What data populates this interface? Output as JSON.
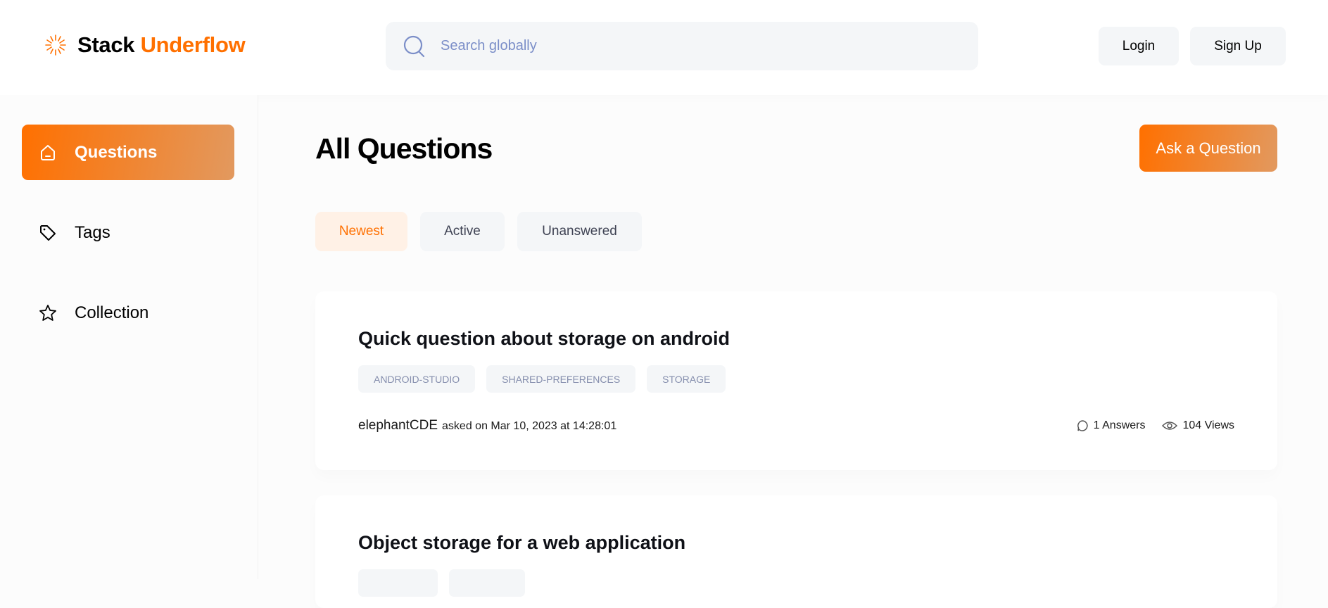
{
  "header": {
    "brand_first": "Stack",
    "brand_second": "Underflow",
    "search_placeholder": "Search globally",
    "login": "Login",
    "signup": "Sign Up"
  },
  "sidebar": {
    "items": [
      {
        "label": "Questions",
        "icon": "home-icon",
        "active": true
      },
      {
        "label": "Tags",
        "icon": "tag-icon"
      },
      {
        "label": "Collection",
        "icon": "star-icon"
      }
    ]
  },
  "main": {
    "title": "All Questions",
    "ask_button": "Ask a Question",
    "filters": [
      {
        "label": "Newest",
        "active": true
      },
      {
        "label": "Active"
      },
      {
        "label": "Unanswered"
      }
    ],
    "questions": [
      {
        "title": "Quick question about storage on android",
        "tags": [
          "android-studio",
          "shared-preferences",
          "storage"
        ],
        "author": "elephantCDE",
        "asked": "asked on Mar 10, 2023 at 14:28:01",
        "answers": "1 Answers",
        "views": "104 Views"
      },
      {
        "title": "Object storage for a web application"
      }
    ]
  },
  "colors": {
    "accent": "#ff7000",
    "accent_light": "#fff1e6",
    "surface": "#f4f6f8"
  }
}
